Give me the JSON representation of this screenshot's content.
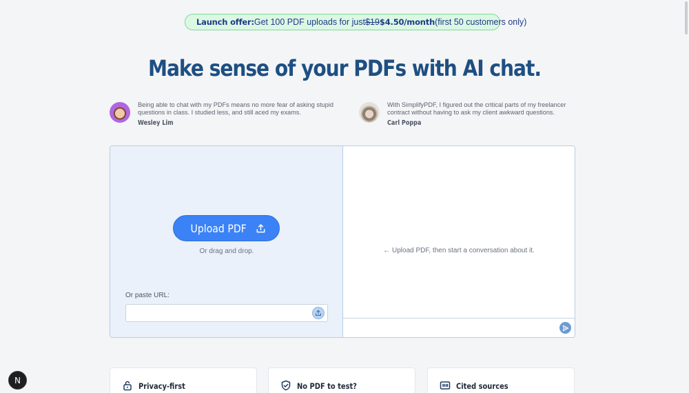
{
  "banner": {
    "strong": "Launch offer:",
    "text_before": "Get 100 PDF uploads for just",
    "old_price": "$19",
    "new_price": "$4.50/month",
    "text_after": "(first 50 customers only)"
  },
  "headline": "Make sense of your PDFs with AI chat.",
  "testimonials": [
    {
      "quote": "Being able to chat with my PDFs means no more fear of asking stupid questions in class. I studied less, and still aced my exams.",
      "author": "Wesley Lim"
    },
    {
      "quote": "With SimplifyPDF, I figured out the critical parts of my freelancer contract without having to ask my client awkward questions.",
      "author": "Carl Poppa"
    }
  ],
  "upload": {
    "button_label": "Upload PDF",
    "drag_text": "Or drag and drop.",
    "paste_label": "Or paste URL:",
    "url_value": ""
  },
  "chat": {
    "hint": "← Upload PDF, then start a conversation about it.",
    "input_value": ""
  },
  "features": [
    {
      "title": "Privacy-first",
      "icon": "lock-icon"
    },
    {
      "title": "No PDF to test?",
      "icon": "shield-check-icon"
    },
    {
      "title": "Cited sources",
      "icon": "quote-icon"
    }
  ],
  "dev_badge": "N",
  "colors": {
    "headline": "#1e4f82",
    "primary_button": "#3b82f6",
    "banner_bg": "#dcf8e3",
    "banner_border": "#7ed99a",
    "upload_panel_bg": "#eaf1fa"
  }
}
